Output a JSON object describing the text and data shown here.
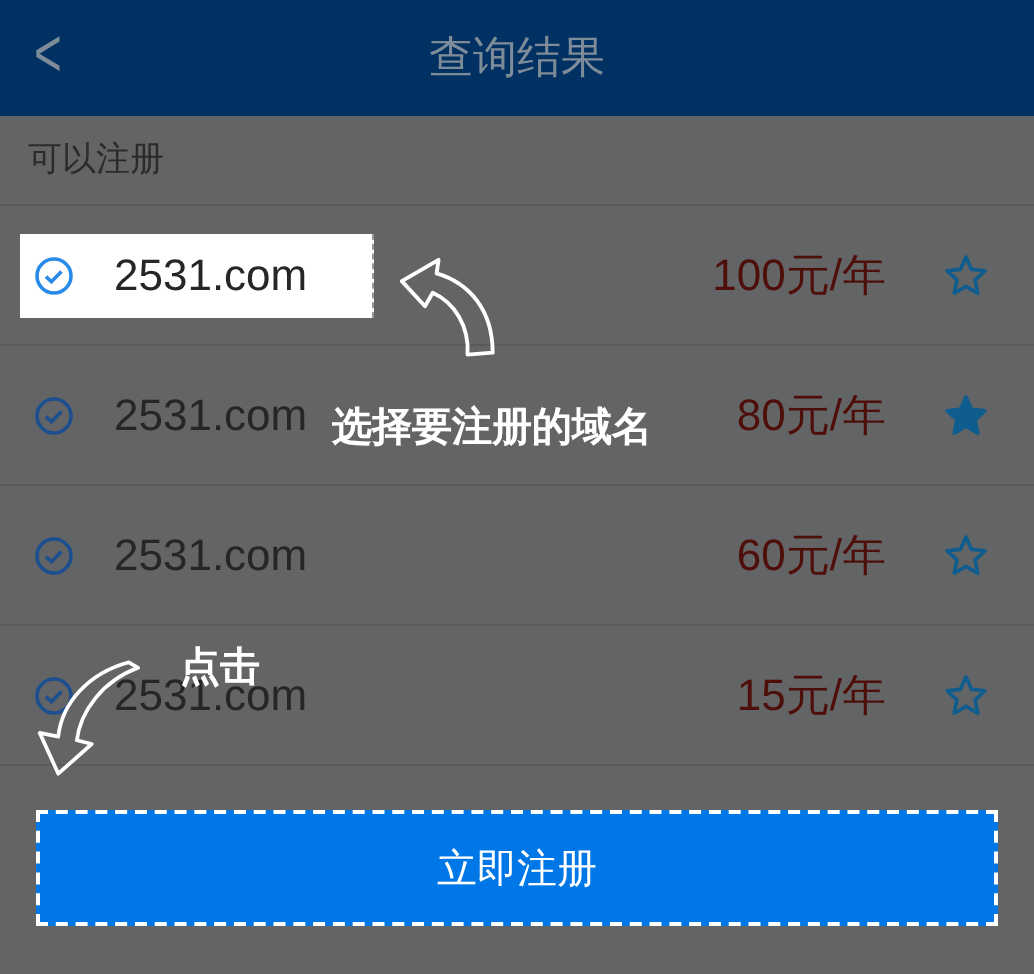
{
  "header": {
    "back": "<",
    "title": "查询结果"
  },
  "section_label": "可以注册",
  "rows": [
    {
      "domain": "2531.com",
      "price": "100元/年",
      "favorite": false,
      "highlighted": true
    },
    {
      "domain": "2531.com",
      "price": "80元/年",
      "favorite": true,
      "highlighted": false
    },
    {
      "domain": "2531.com",
      "price": "60元/年",
      "favorite": false,
      "highlighted": false
    },
    {
      "domain": "2531.com",
      "price": "15元/年",
      "favorite": false,
      "highlighted": false
    }
  ],
  "guide": {
    "select_hint": "选择要注册的域名",
    "click_hint": "点击"
  },
  "register_button": "立即注册"
}
